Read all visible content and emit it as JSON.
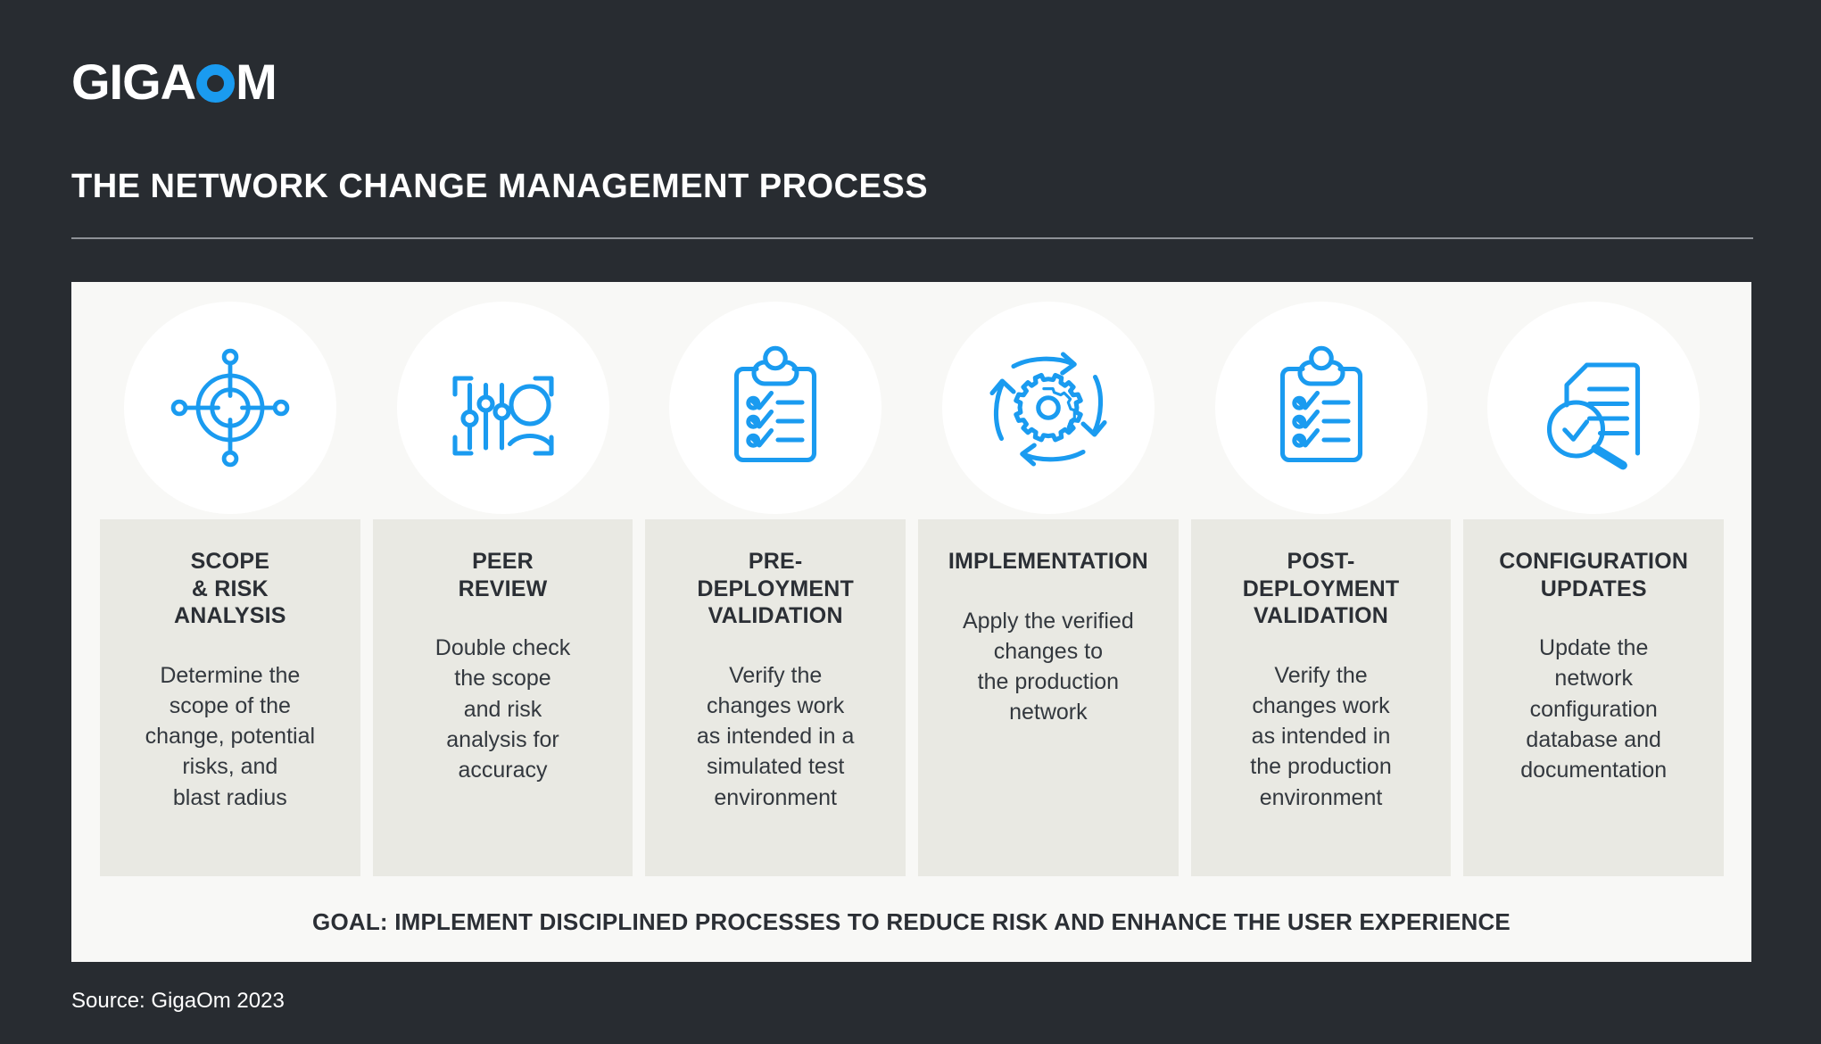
{
  "brand": {
    "logo_part1": "GIGA",
    "logo_o": "O",
    "logo_part2": "M",
    "accent_blue": "#1a9bf0",
    "dark_bg": "#282c31",
    "card_bg": "#f8f8f6",
    "panel_bg": "#e9e9e3"
  },
  "header": {
    "title": "THE NETWORK CHANGE MANAGEMENT PROCESS"
  },
  "steps": [
    {
      "icon": "target-crosshair-icon",
      "title": "SCOPE\n& RISK\nANALYSIS",
      "body": "Determine the\nscope of the\nchange, potential\nrisks, and\nblast radius"
    },
    {
      "icon": "sliders-person-review-icon",
      "title": "PEER\nREVIEW",
      "body": "Double check\nthe scope\nand risk\nanalysis for\naccuracy"
    },
    {
      "icon": "clipboard-checklist-icon",
      "title": "PRE-\nDEPLOYMENT\nVALIDATION",
      "body": "Verify the\nchanges work\nas intended in a\nsimulated test\nenvironment"
    },
    {
      "icon": "gear-cycle-arrows-icon",
      "title": "IMPLEMENTATION",
      "body": "Apply the verified\nchanges to\nthe production\nnetwork"
    },
    {
      "icon": "clipboard-checklist-icon",
      "title": "POST-\nDEPLOYMENT\nVALIDATION",
      "body": "Verify the\nchanges work\nas intended in\nthe production\nenvironment"
    },
    {
      "icon": "document-magnifier-check-icon",
      "title": "CONFIGURATION\nUPDATES",
      "body": "Update the\nnetwork\nconfiguration\ndatabase and\ndocumentation"
    }
  ],
  "goal": {
    "text": "GOAL: IMPLEMENT DISCIPLINED PROCESSES TO REDUCE RISK AND ENHANCE THE USER EXPERIENCE"
  },
  "footer": {
    "source": "Source: GigaOm 2023"
  }
}
